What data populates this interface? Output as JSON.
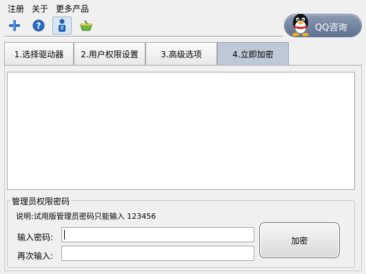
{
  "menu": {
    "register": "注册",
    "about": "关于",
    "more_products": "更多产品"
  },
  "toolbar": {
    "buttons": [
      {
        "icon": "add-icon"
      },
      {
        "icon": "help-icon"
      },
      {
        "icon": "user-icon"
      },
      {
        "icon": "basket-icon"
      }
    ]
  },
  "qq_button": {
    "label": "QQ咨询",
    "icon": "qq-penguin-icon"
  },
  "tabs": [
    {
      "label": "1.选择驱动器"
    },
    {
      "label": "2.用户权限设置"
    },
    {
      "label": "3.高级选项"
    },
    {
      "label": "4.立即加密",
      "active": true
    }
  ],
  "log": {
    "text": ""
  },
  "admin_group": {
    "title": "管理员权限密码",
    "note": "说明:试用版管理员密码只能输入 123456",
    "password_label": "输入密码:",
    "password_value": "",
    "confirm_label": "再次输入:",
    "confirm_value": "",
    "encrypt_button": "加密"
  },
  "colors": {
    "active_tab": "#bfc8d6",
    "qq_button": "#6f7f9c"
  }
}
